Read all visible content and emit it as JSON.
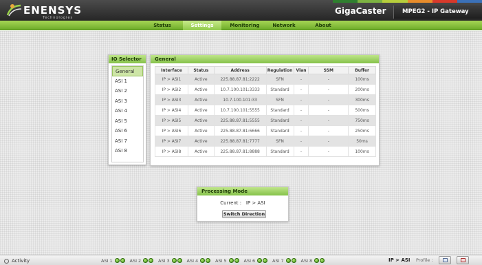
{
  "header": {
    "logo_main": "ENENSYS",
    "logo_sub": "Technologies",
    "product": "GigaCaster",
    "gateway": "MPEG2 - IP Gateway",
    "stripe_colors": [
      "#2f7f2f",
      "#7db342",
      "#b7cf3c",
      "#e88c2b",
      "#d8392b",
      "#3b71b8"
    ]
  },
  "nav": {
    "items": [
      {
        "label": "Status"
      },
      {
        "label": "Settings"
      },
      {
        "label": "Monitoring"
      },
      {
        "label": "Network"
      },
      {
        "label": "About"
      }
    ],
    "active": "Settings"
  },
  "io_selector": {
    "title": "IO Selector",
    "items": [
      "General",
      "ASI 1",
      "ASI 2",
      "ASI 3",
      "ASI 4",
      "ASI 5",
      "ASI 6",
      "ASI 7",
      "ASI 8"
    ],
    "selected": "General"
  },
  "general": {
    "title": "General",
    "columns": [
      "Interface",
      "Status",
      "Address",
      "Regulation",
      "Vlan",
      "SSM",
      "Buffer"
    ],
    "rows": [
      [
        "IP > ASI1",
        "Active",
        "225.88.87.81:2222",
        "SFN",
        "-",
        "-",
        "100ms"
      ],
      [
        "IP > ASI2",
        "Active",
        "10.7.100.101:3333",
        "Standard",
        "-",
        "-",
        "200ms"
      ],
      [
        "IP > ASI3",
        "Active",
        "10.7.100.101:33",
        "SFN",
        "-",
        "-",
        "300ms"
      ],
      [
        "IP > ASI4",
        "Active",
        "10.7.100.101:5555",
        "Standard",
        "-",
        "-",
        "500ms"
      ],
      [
        "IP > ASI5",
        "Active",
        "225.88.87.81:5555",
        "Standard",
        "-",
        "-",
        "750ms"
      ],
      [
        "IP > ASI6",
        "Active",
        "225.88.87.81:6666",
        "Standard",
        "-",
        "-",
        "250ms"
      ],
      [
        "IP > ASI7",
        "Active",
        "225.88.87.81:7777",
        "SFN",
        "-",
        "-",
        "50ms"
      ],
      [
        "IP > ASI8",
        "Active",
        "225.88.87.81:8888",
        "Standard",
        "-",
        "-",
        "100ms"
      ]
    ]
  },
  "processing": {
    "title": "Processing Mode",
    "current_label": "Current :",
    "current_value": "IP > ASI",
    "button": "Switch Direction"
  },
  "statusbar": {
    "activity": "Activity",
    "asi": [
      "ASI 1",
      "ASI 2",
      "ASI 3",
      "ASI 4",
      "ASI 5",
      "ASI 6",
      "ASI 7",
      "ASI 8"
    ],
    "mode": "IP > ASI",
    "profile_label": "Profile :",
    "led_color": "#4caf1e"
  }
}
